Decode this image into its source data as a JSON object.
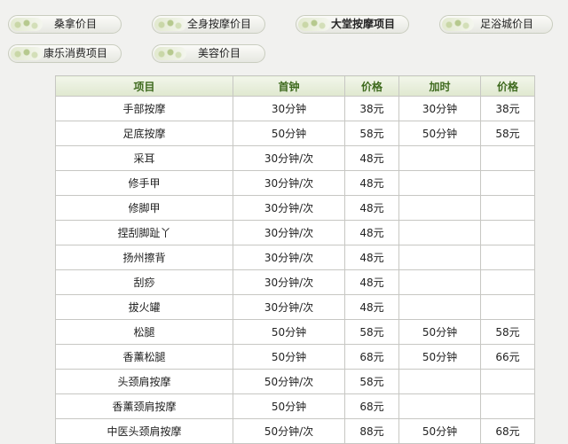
{
  "tabs": [
    {
      "label": "桑拿价目"
    },
    {
      "label": "全身按摩价目"
    },
    {
      "label": "大堂按摩项目"
    },
    {
      "label": "足浴城价目"
    },
    {
      "label": "康乐消费项目"
    },
    {
      "label": "美容价目"
    }
  ],
  "active_tab": "大堂按摩项目",
  "table": {
    "headers": [
      "项目",
      "首钟",
      "价格",
      "加时",
      "价格"
    ],
    "rows": [
      [
        "手部按摩",
        "30分钟",
        "38元",
        "30分钟",
        "38元"
      ],
      [
        "足底按摩",
        "50分钟",
        "58元",
        "50分钟",
        "58元"
      ],
      [
        "采耳",
        "30分钟/次",
        "48元",
        "",
        ""
      ],
      [
        "修手甲",
        "30分钟/次",
        "48元",
        "",
        ""
      ],
      [
        "修脚甲",
        "30分钟/次",
        "48元",
        "",
        ""
      ],
      [
        "捏刮脚趾丫",
        "30分钟/次",
        "48元",
        "",
        ""
      ],
      [
        "扬州擦背",
        "30分钟/次",
        "48元",
        "",
        ""
      ],
      [
        "刮痧",
        "30分钟/次",
        "48元",
        "",
        ""
      ],
      [
        "拔火罐",
        "30分钟/次",
        "48元",
        "",
        ""
      ],
      [
        "松腿",
        "50分钟",
        "58元",
        "50分钟",
        "58元"
      ],
      [
        "香薰松腿",
        "50分钟",
        "68元",
        "50分钟",
        "66元"
      ],
      [
        "头颈肩按摩",
        "50分钟/次",
        "58元",
        "",
        ""
      ],
      [
        "香薰颈肩按摩",
        "50分钟",
        "68元",
        "",
        ""
      ],
      [
        "中医头颈肩按摩",
        "50分钟/次",
        "88元",
        "50分钟",
        "68元"
      ]
    ]
  }
}
